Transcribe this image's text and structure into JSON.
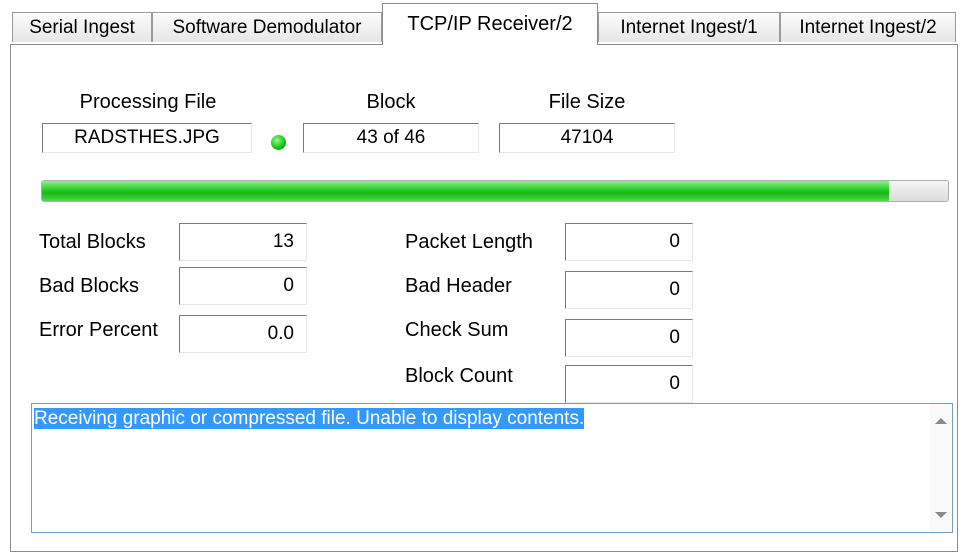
{
  "tabs": [
    {
      "label": "Serial Ingest"
    },
    {
      "label": "Software Demodulator"
    },
    {
      "label": "TCP/IP Receiver/2",
      "active": true
    },
    {
      "label": "Internet Ingest/1"
    },
    {
      "label": "Internet Ingest/2"
    }
  ],
  "file_info": {
    "processing_file_label": "Processing File",
    "processing_file_value": "RADSTHES.JPG",
    "block_label": "Block",
    "block_value": "43 of 46",
    "file_size_label": "File Size",
    "file_size_value": "47104",
    "status_led_color": "#10c010"
  },
  "progress": {
    "fraction": 0.935
  },
  "stats_left": [
    {
      "label": "Total Blocks",
      "value": "13"
    },
    {
      "label": "Bad Blocks",
      "value": "0"
    },
    {
      "label": "Error Percent",
      "value": "0.0"
    }
  ],
  "stats_right": [
    {
      "label": "Packet Length",
      "value": "0"
    },
    {
      "label": "Bad Header",
      "value": "0"
    },
    {
      "label": "Check Sum",
      "value": "0"
    },
    {
      "label": "Block Count",
      "value": "0"
    }
  ],
  "message_box": {
    "text": "Receiving graphic or compressed file. Unable to display contents."
  }
}
